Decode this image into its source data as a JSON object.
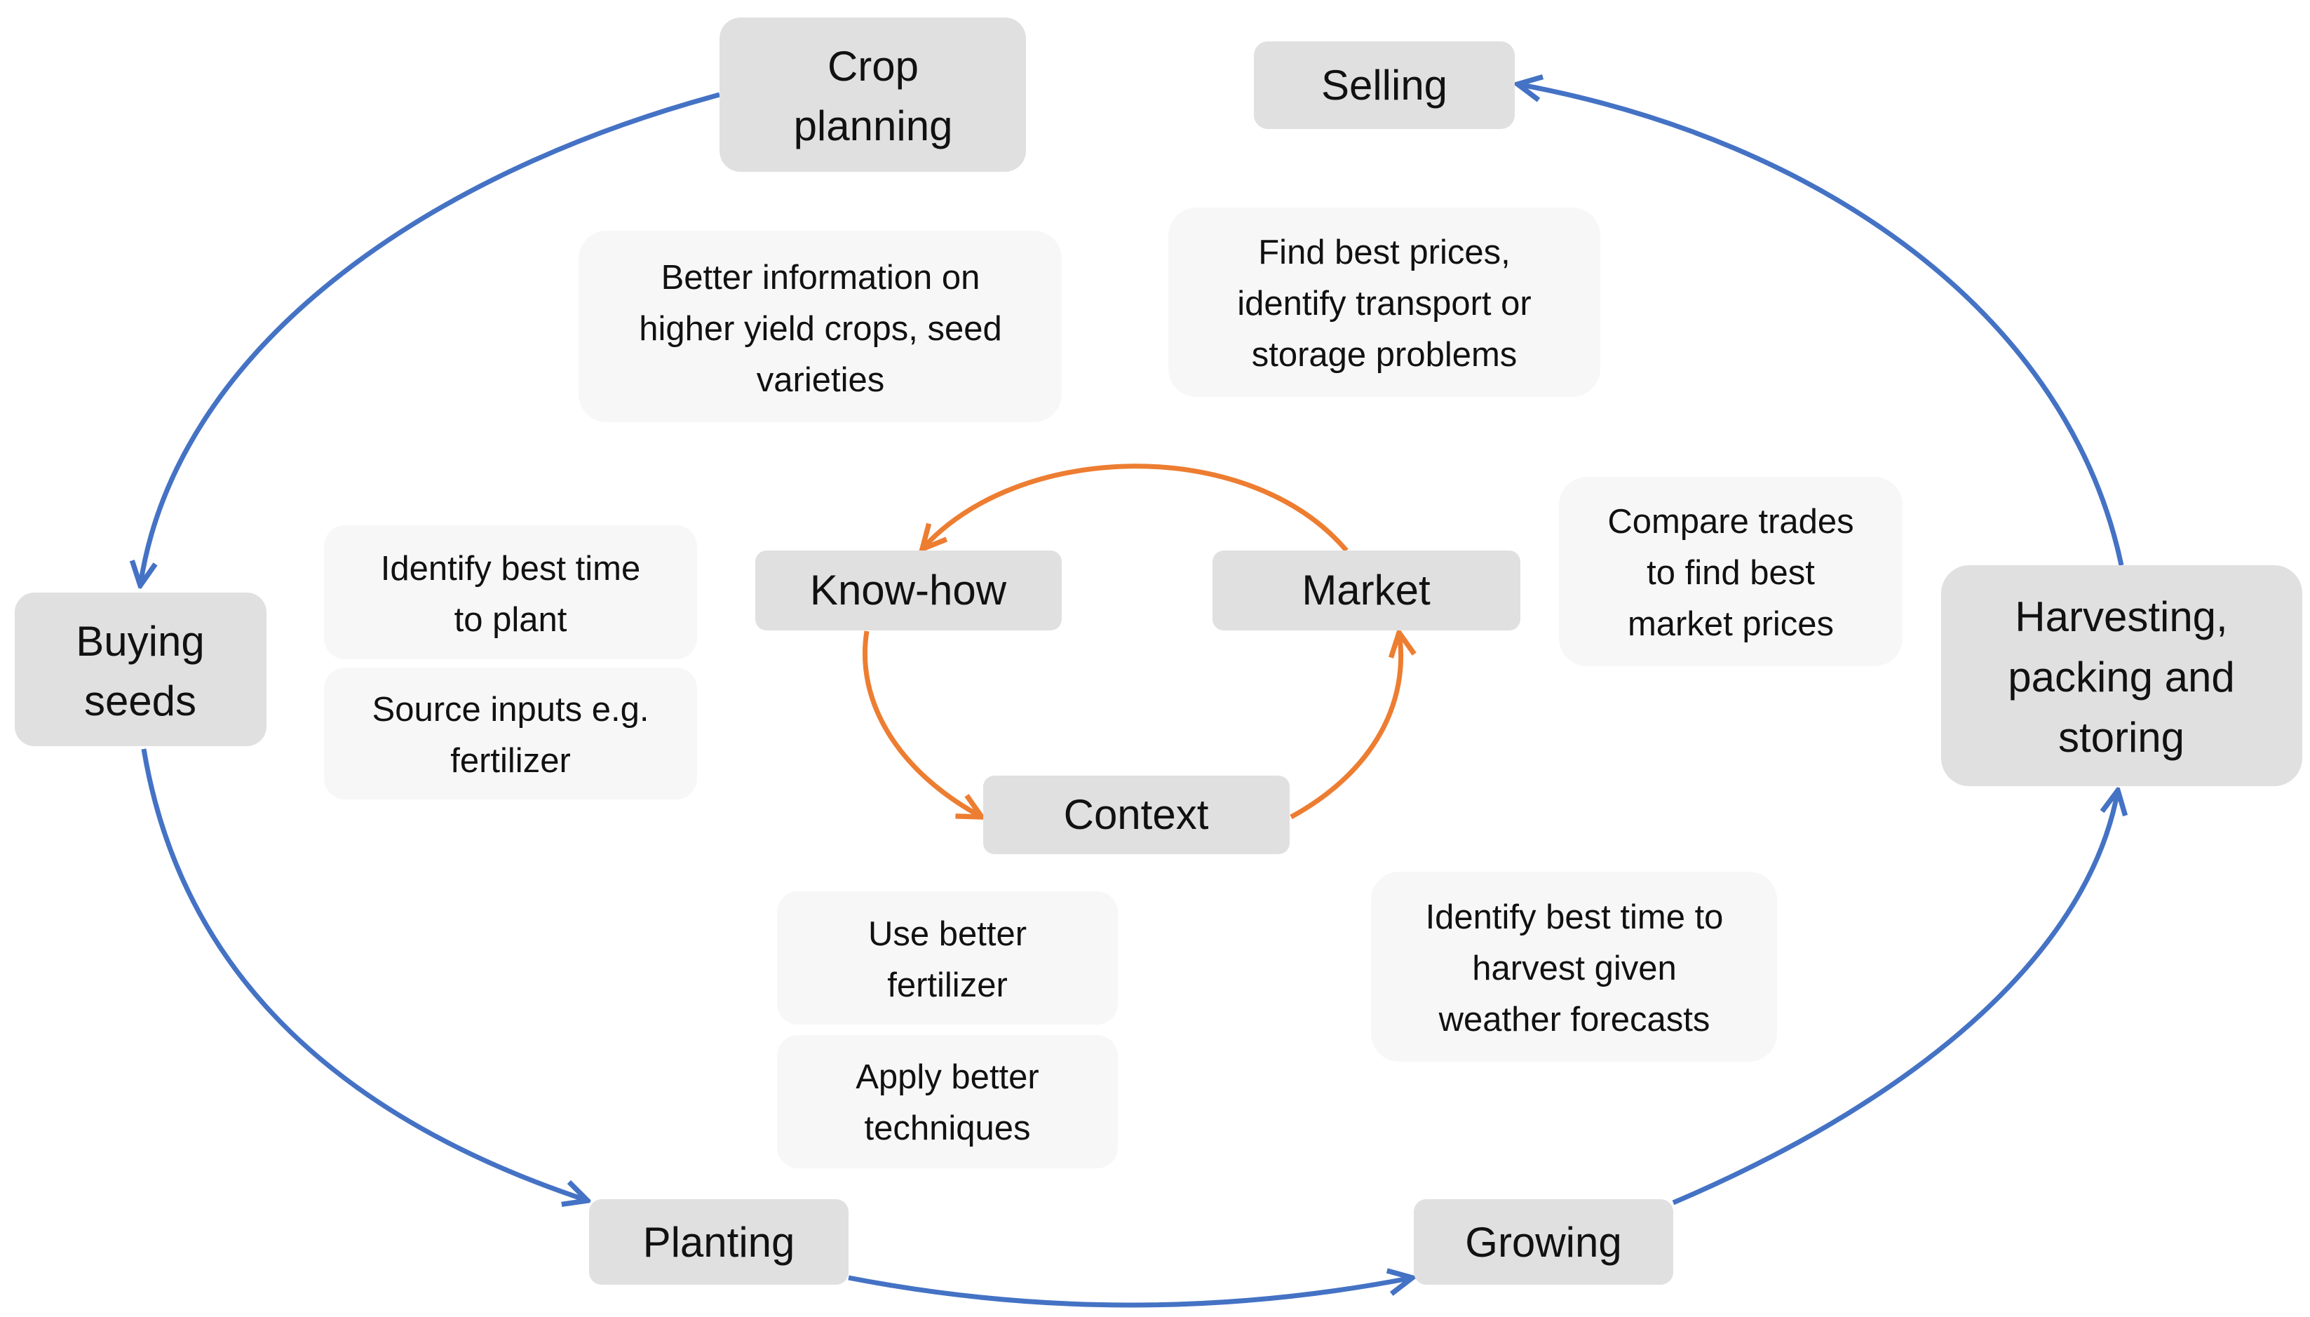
{
  "colors": {
    "outer_cycle": "#4472C4",
    "inner_cycle": "#ED7D31",
    "stage_box": "#E0E0E0",
    "note_box": "#F7F7F7"
  },
  "stages": {
    "crop_planning": [
      "Crop",
      "planning"
    ],
    "selling": [
      "Selling"
    ],
    "buying_seeds": [
      "Buying",
      "seeds"
    ],
    "harvesting": [
      "Harvesting,",
      "packing and",
      "storing"
    ],
    "planting": [
      "Planting"
    ],
    "growing": [
      "Growing"
    ]
  },
  "inner": {
    "know_how": "Know-how",
    "market": "Market",
    "context": "Context"
  },
  "notes": {
    "better_info": [
      "Better information on",
      "higher yield crops, seed",
      "varieties"
    ],
    "best_prices": [
      "Find best prices,",
      "identify transport or",
      "storage problems"
    ],
    "compare_trades": [
      "Compare trades",
      "to find best",
      "market prices"
    ],
    "time_to_plant": [
      "Identify best time",
      "to plant"
    ],
    "source_inputs": [
      "Source inputs e.g.",
      "fertilizer"
    ],
    "better_fertilizer": [
      "Use better",
      "fertilizer"
    ],
    "better_techniques": [
      "Apply better",
      "techniques"
    ],
    "time_to_harvest": [
      "Identify best time to",
      "harvest given",
      "weather forecasts"
    ]
  }
}
